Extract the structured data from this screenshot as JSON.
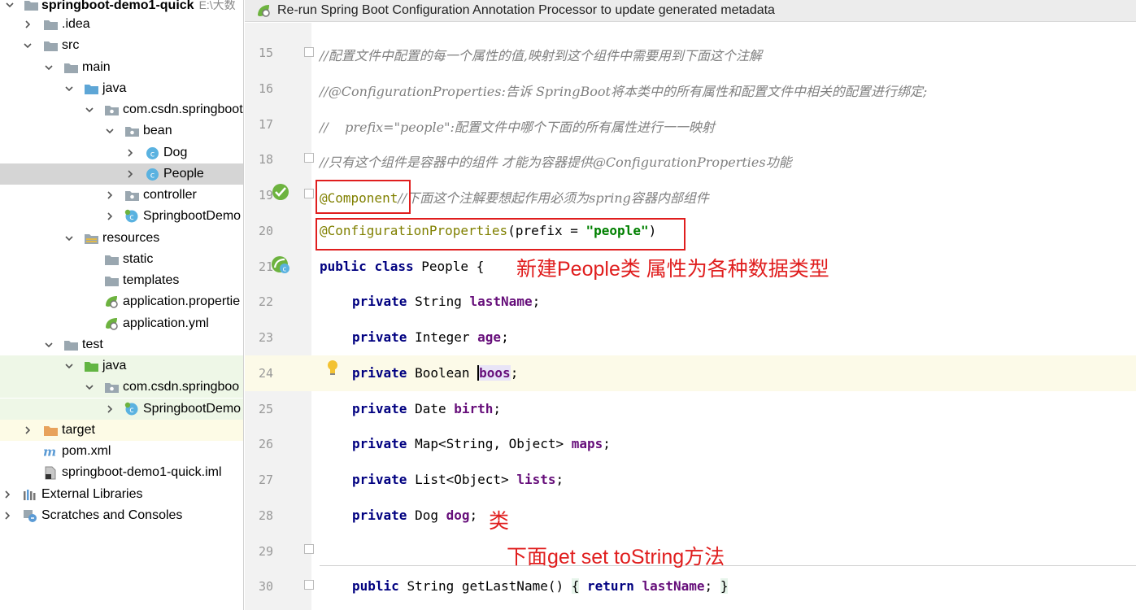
{
  "tree": {
    "project_name": "springboot-demo1-quick",
    "project_path": "E:\\大数",
    "items": [
      {
        "label": "springboot-demo1-quick"
      },
      {
        "label": ".idea"
      },
      {
        "label": "src"
      },
      {
        "label": "main"
      },
      {
        "label": "java"
      },
      {
        "label": "com.csdn.springboot"
      },
      {
        "label": "bean"
      },
      {
        "label": "Dog"
      },
      {
        "label": "People"
      },
      {
        "label": "controller"
      },
      {
        "label": "SpringbootDemo"
      },
      {
        "label": "resources"
      },
      {
        "label": "static"
      },
      {
        "label": "templates"
      },
      {
        "label": "application.propertie"
      },
      {
        "label": "application.yml"
      },
      {
        "label": "test"
      },
      {
        "label": "java"
      },
      {
        "label": "com.csdn.springboo"
      },
      {
        "label": "SpringbootDemo"
      },
      {
        "label": "target"
      },
      {
        "label": "pom.xml"
      },
      {
        "label": "springboot-demo1-quick.iml"
      },
      {
        "label": "External Libraries"
      },
      {
        "label": "Scratches and Consoles"
      }
    ]
  },
  "banner": {
    "text": "Re-run Spring Boot Configuration Annotation Processor to update generated metadata"
  },
  "editor": {
    "line_numbers": [
      "15",
      "16",
      "17",
      "18",
      "19",
      "20",
      "21",
      "22",
      "23",
      "24",
      "25",
      "26",
      "27",
      "28",
      "29",
      "30"
    ],
    "c15": "//配置文件中配置的每一个属性的值,映射到这个组件中需要用到下面这个注解",
    "c16": "//@ConfigurationProperties:告诉 SpringBoot将本类中的所有属性和配置文件中相关的配置进行绑定;",
    "c17": "//    prefix=\"people\":配置文件中哪个下面的所有属性进行一一映射",
    "c18": "//只有这个组件是容器中的组件 才能为容器提供@ConfigurationProperties功能",
    "l19_ann": "@Component",
    "l19_cmt": "//下面这个注解要想起作用必须为spring容器内部组件",
    "l20_ann": "@ConfigurationProperties",
    "l20_open": "(prefix = ",
    "l20_str": "\"people\"",
    "l20_close": ")",
    "kw_public": "public",
    "kw_class": "class",
    "kw_private": "private",
    "kw_return": "return",
    "class_name": "People",
    "open_brace": "{",
    "t22": "String",
    "f22": "lastName",
    "t23": "Integer",
    "f23": "age",
    "t24": "Boolean",
    "f24": "boos",
    "t25": "Date",
    "f25": "birth",
    "t26": "Map<String, Object>",
    "f26": "maps",
    "t27": "List<Object>",
    "f27": "lists",
    "t28": "Dog",
    "f28": "dog",
    "semi": ";",
    "l30_type": "String",
    "l30_method": "getLastName()",
    "l30_lb": "{",
    "l30_field": "lastName",
    "l30_rb": "}"
  },
  "annotations": {
    "note1": "新建People类 属性为各种数据类型",
    "note2": "类",
    "note3": "下面get set toString方法"
  }
}
